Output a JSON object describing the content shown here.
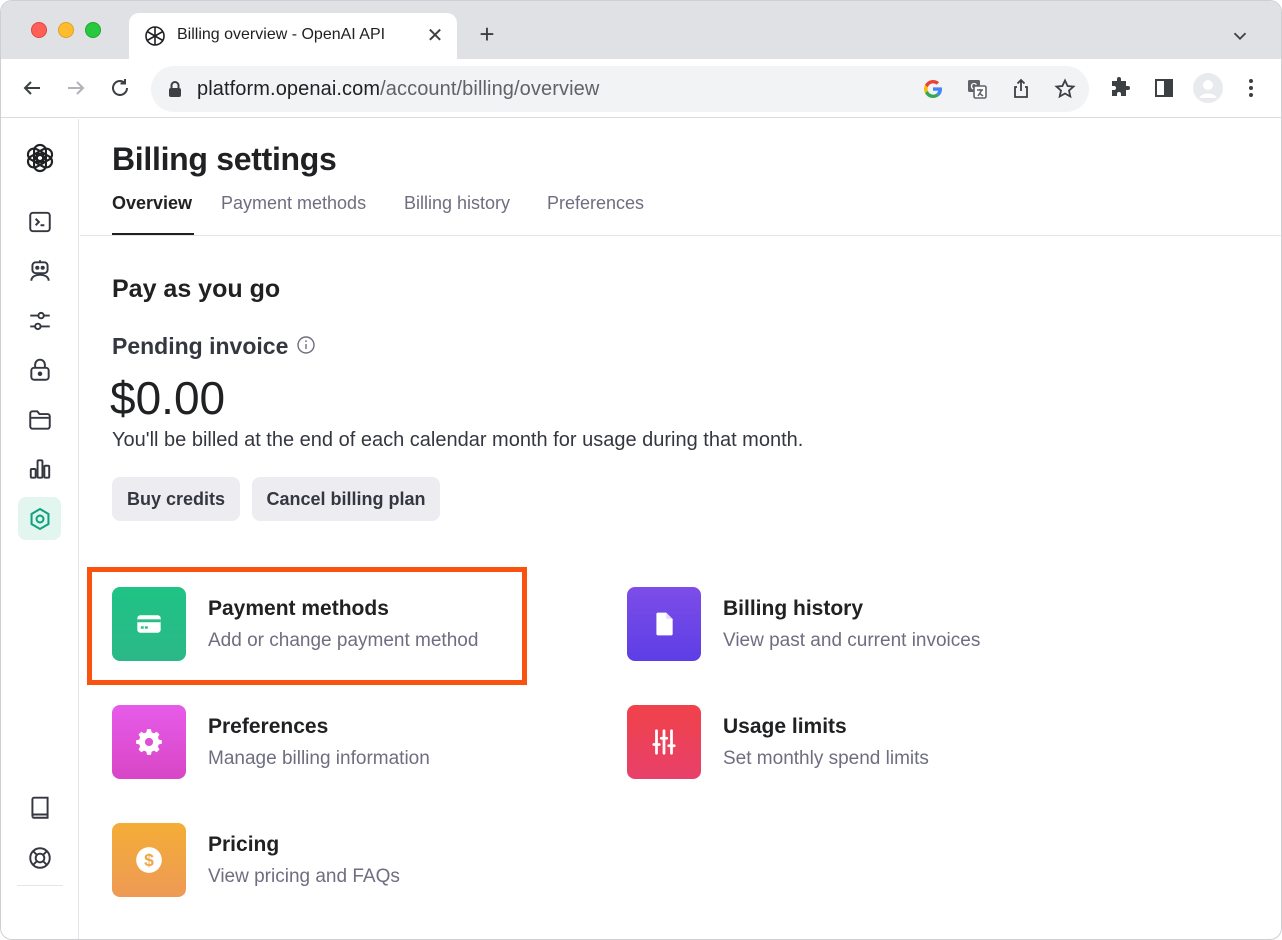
{
  "browser": {
    "tab_title": "Billing overview - OpenAI API",
    "tab_close": "✕",
    "new_tab": "+",
    "url_host": "platform.openai.com",
    "url_path": "/account/billing/overview"
  },
  "page": {
    "title": "Billing settings",
    "tabs": [
      {
        "label": "Overview",
        "active": true
      },
      {
        "label": "Payment methods",
        "active": false
      },
      {
        "label": "Billing history",
        "active": false
      },
      {
        "label": "Preferences",
        "active": false
      }
    ],
    "section_title": "Pay as you go",
    "pending_label": "Pending invoice",
    "amount": "$0.00",
    "billing_note": "You'll be billed at the end of each calendar month for usage during that month.",
    "buttons": {
      "buy_credits": "Buy credits",
      "cancel_plan": "Cancel billing plan"
    }
  },
  "cards": [
    {
      "title": "Payment methods",
      "subtitle": "Add or change payment method",
      "icon": "credit-card-icon",
      "color_top": "#19c37d",
      "color_bottom": "#2eb88a"
    },
    {
      "title": "Billing history",
      "subtitle": "View past and current invoices",
      "icon": "document-icon",
      "color_top": "#7b4ce6",
      "color_bottom": "#5e3ee6"
    },
    {
      "title": "Preferences",
      "subtitle": "Manage billing information",
      "icon": "gear-icon",
      "color_top": "#e25ce8",
      "color_bottom": "#d946c4"
    },
    {
      "title": "Usage limits",
      "subtitle": "Set monthly spend limits",
      "icon": "sliders-icon",
      "color_top": "#ef4146",
      "color_bottom": "#e94069"
    },
    {
      "title": "Pricing",
      "subtitle": "View pricing and FAQs",
      "icon": "dollar-icon",
      "color_top": "#f4ac36",
      "color_bottom": "#ee9b55"
    }
  ],
  "colors": {
    "accent_green": "#10a37f",
    "highlight": "#fa520f"
  }
}
